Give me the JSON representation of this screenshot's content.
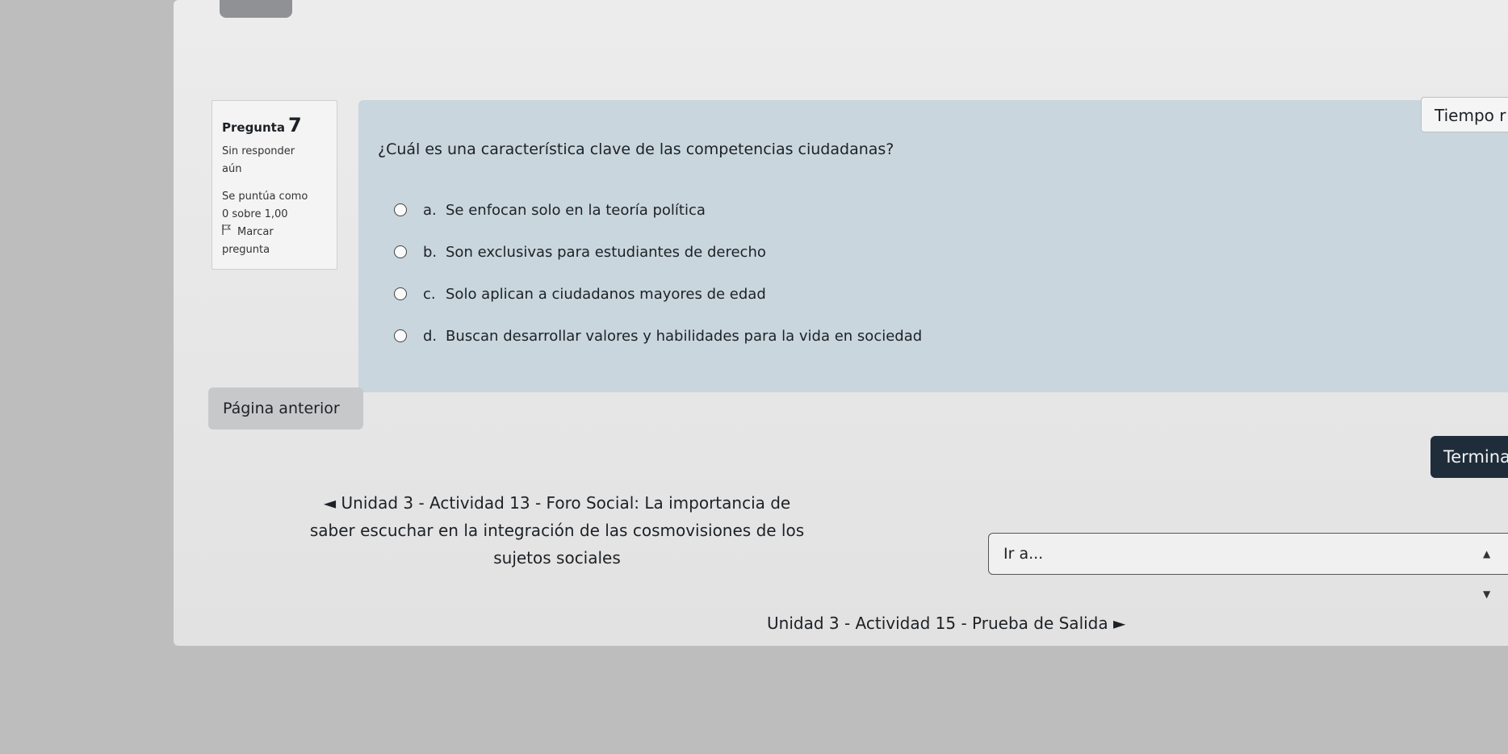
{
  "question_info": {
    "label": "Pregunta",
    "number": "7",
    "status_line1": "Sin responder",
    "status_line2": "aún",
    "score_line1": "Se puntúa como",
    "score_line2": "0 sobre 1,00",
    "flag_label_line1": "Marcar",
    "flag_label_line2": "pregunta"
  },
  "question": {
    "text": "¿Cuál es una característica clave de las competencias ciudadanas?",
    "options": [
      {
        "letter": "a.",
        "text": "Se enfocan solo en la teoría política"
      },
      {
        "letter": "b.",
        "text": "Son exclusivas para estudiantes de derecho"
      },
      {
        "letter": "c.",
        "text": "Solo aplican a ciudadanos mayores de edad"
      },
      {
        "letter": "d.",
        "text": "Buscan desarrollar valores y habilidades para la vida en sociedad"
      }
    ]
  },
  "timer": {
    "label": "Tiempo r"
  },
  "nav": {
    "prev_page": "Página anterior",
    "finish": "Termina",
    "prev_activity_arrow": "◄",
    "prev_activity": "Unidad 3 - Actividad 13 - Foro Social: La importancia de saber escuchar en la integración de las cosmovisiones de los sujetos sociales",
    "jump_placeholder": "Ir a...",
    "next_activity": "Unidad 3 - Actividad 15 - Prueba de Salida",
    "next_activity_arrow": "►"
  },
  "colors": {
    "question_bg": "#c9d6de",
    "finish_bg": "#1f2d3b"
  }
}
